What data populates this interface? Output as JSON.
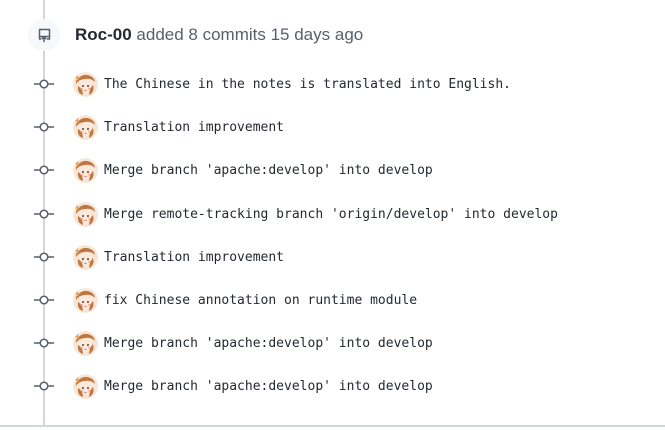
{
  "header": {
    "author": "Roc-00",
    "summary": "added 8 commits 15 days ago",
    "event_icon": "repo-push-icon"
  },
  "commit_icon": "git-commit-icon",
  "commits": [
    {
      "message": "The Chinese in the notes is translated into English."
    },
    {
      "message": "Translation improvement"
    },
    {
      "message": "Merge branch 'apache:develop' into develop"
    },
    {
      "message": "Merge remote-tracking branch 'origin/develop' into develop"
    },
    {
      "message": "Translation improvement"
    },
    {
      "message": "fix Chinese annotation on runtime module"
    },
    {
      "message": "Merge branch 'apache:develop' into develop"
    },
    {
      "message": "Merge branch 'apache:develop' into develop"
    }
  ],
  "colors": {
    "timeline": "#d0d7de",
    "text": "#24292f",
    "muted": "#57606a"
  }
}
